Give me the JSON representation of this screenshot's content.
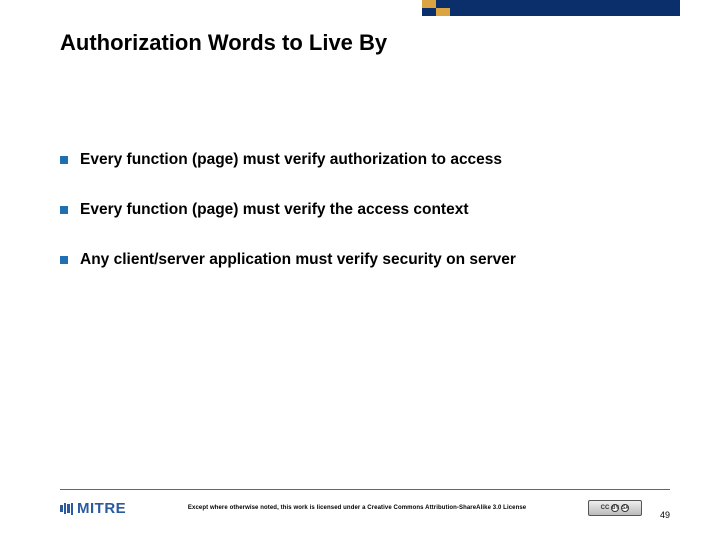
{
  "title": "Authorization Words to Live By",
  "bullets": [
    "Every function (page) must verify authorization to access",
    "Every function (page) must verify the access context",
    "Any client/server application must verify security on server"
  ],
  "footer": {
    "logo_text": "MITRE",
    "license_text": "Except where otherwise noted, this work is licensed under a Creative Commons Attribution-ShareAlike 3.0 License",
    "page_number": "49"
  },
  "accent": {
    "gold": "#d9a441",
    "navy": "#0a2f6b"
  }
}
